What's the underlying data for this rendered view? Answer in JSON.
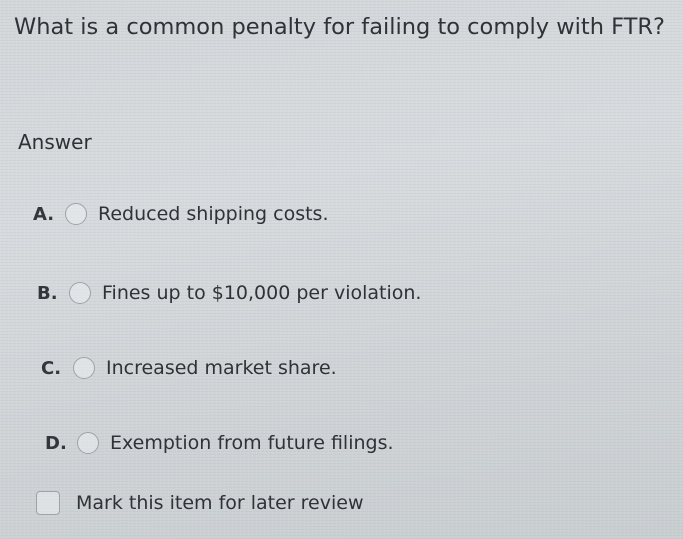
{
  "question": {
    "text": "What is a common penalty for failing to comply with FTR?"
  },
  "answer_heading": "Answer",
  "options": [
    {
      "letter": "A.",
      "text": "Reduced shipping costs.",
      "selected": false
    },
    {
      "letter": "B.",
      "text": "Fines up to $10,000 per violation.",
      "selected": false
    },
    {
      "letter": "C.",
      "text": "Increased market share.",
      "selected": false
    },
    {
      "letter": "D.",
      "text": "Exemption from future filings.",
      "selected": false
    }
  ],
  "review": {
    "label": "Mark this item for later review",
    "checked": false
  }
}
